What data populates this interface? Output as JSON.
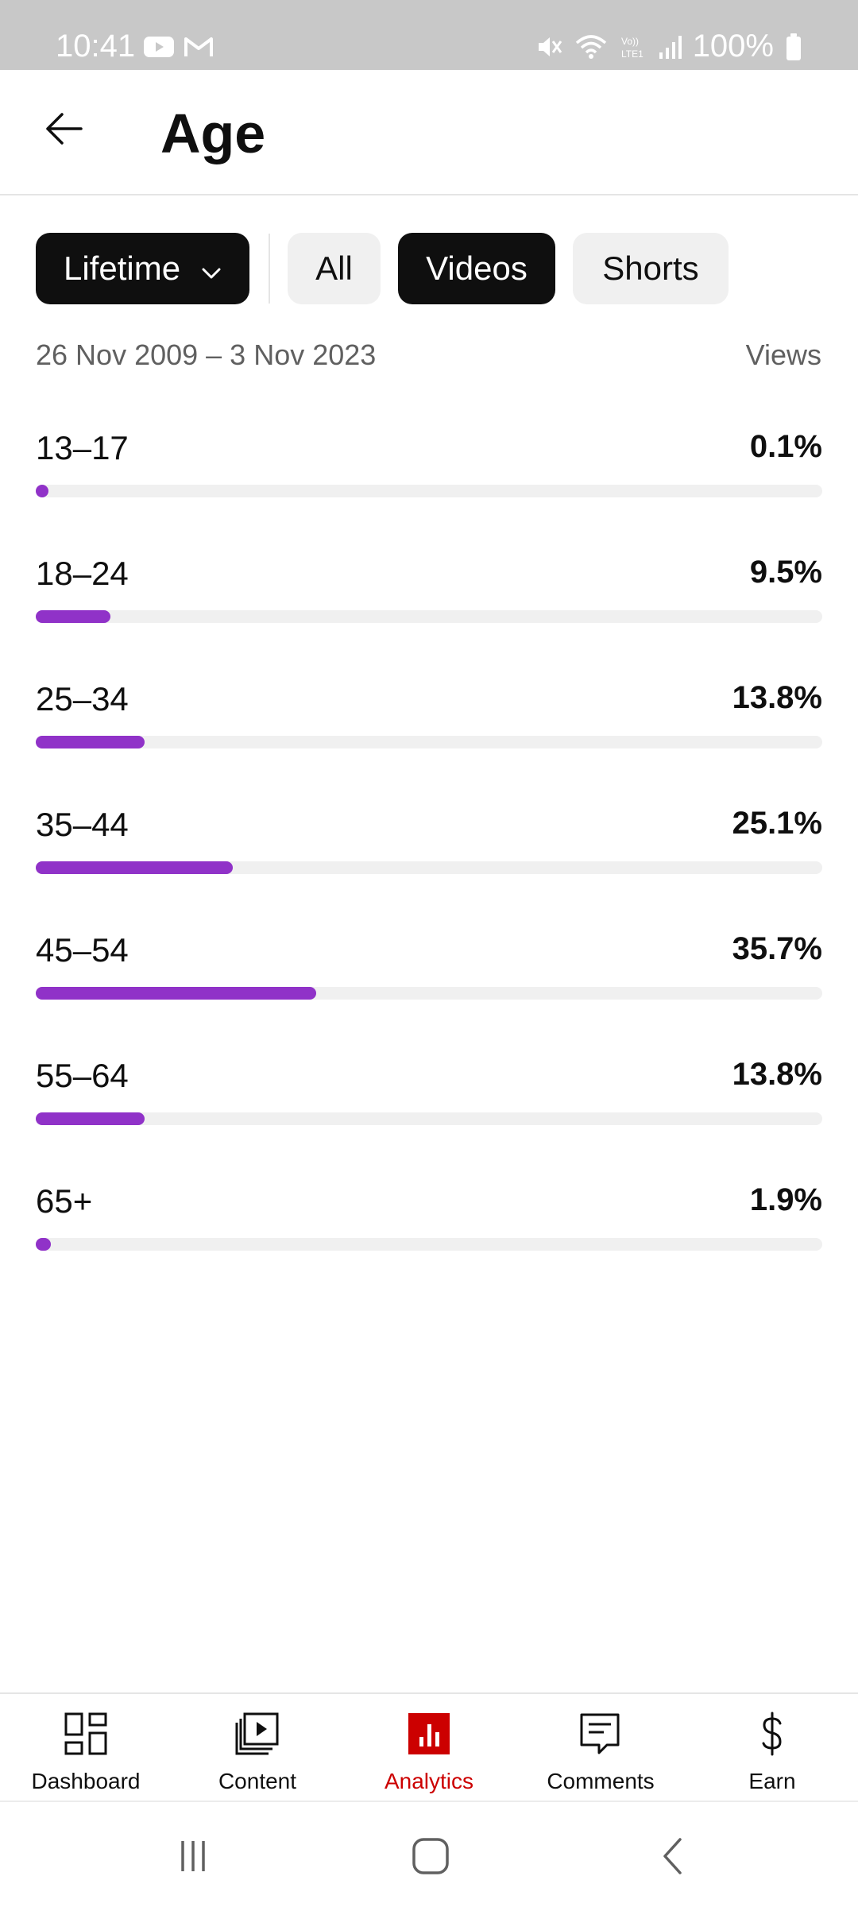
{
  "status_bar": {
    "time": "10:41",
    "battery": "100%",
    "left_icons": [
      "youtube-icon",
      "gmail-icon"
    ],
    "right_icons": [
      "mute-icon",
      "wifi-icon",
      "volte-icon",
      "signal-icon",
      "battery-icon"
    ]
  },
  "header": {
    "title": "Age",
    "back_icon": "arrow-left-icon"
  },
  "filters": {
    "period": "Lifetime",
    "period_icon": "chevron-down-icon",
    "types": [
      {
        "label": "All",
        "selected": false
      },
      {
        "label": "Videos",
        "selected": true
      },
      {
        "label": "Shorts",
        "selected": false
      }
    ]
  },
  "summary": {
    "date_range": "26 Nov 2009 – 3 Nov 2023",
    "metric": "Views"
  },
  "age_groups": [
    {
      "label": "13–17",
      "value": "0.1%",
      "percent": 0.1
    },
    {
      "label": "18–24",
      "value": "9.5%",
      "percent": 9.5
    },
    {
      "label": "25–34",
      "value": "13.8%",
      "percent": 13.8
    },
    {
      "label": "35–44",
      "value": "25.1%",
      "percent": 25.1
    },
    {
      "label": "45–54",
      "value": "35.7%",
      "percent": 35.7
    },
    {
      "label": "55–64",
      "value": "13.8%",
      "percent": 13.8
    },
    {
      "label": "65+",
      "value": "1.9%",
      "percent": 1.9
    }
  ],
  "colors": {
    "bar_fill": "#9032c8",
    "bar_track": "#f0f0f0",
    "active_nav": "#cc0000",
    "chip_dark": "#0f0f0f",
    "chip_light": "#f0f0f0"
  },
  "bottom_nav": {
    "items": [
      {
        "label": "Dashboard",
        "icon": "dashboard-icon",
        "active": false
      },
      {
        "label": "Content",
        "icon": "content-icon",
        "active": false
      },
      {
        "label": "Analytics",
        "icon": "analytics-icon",
        "active": true
      },
      {
        "label": "Comments",
        "icon": "comments-icon",
        "active": false
      },
      {
        "label": "Earn",
        "icon": "dollar-icon",
        "active": false
      }
    ]
  },
  "system_nav": {
    "icons": [
      "recent-apps-icon",
      "home-icon",
      "back-icon"
    ]
  }
}
